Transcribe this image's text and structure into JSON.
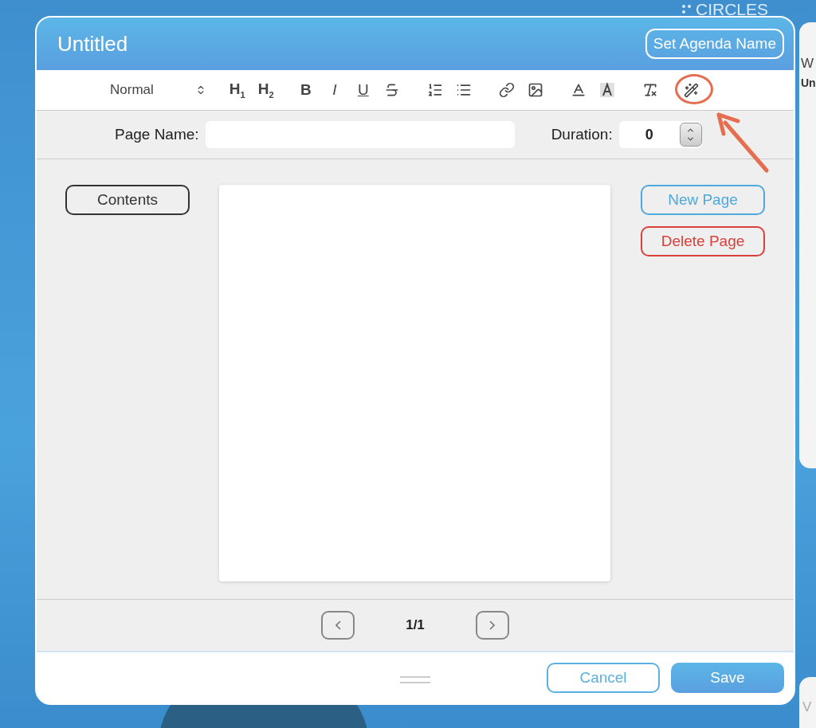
{
  "background": {
    "logo": "CIRCLES",
    "side_title": "W",
    "side_subtitle": "Un",
    "side_footer": "V"
  },
  "dialog": {
    "title": "Untitled",
    "set_name_button": "Set Agenda Name",
    "toolbar": {
      "format_select": "Normal",
      "tools": [
        {
          "kind": "heading",
          "label": "H$_{1}$",
          "highlighted": false
        },
        {
          "kind": "heading",
          "label": "H$_{2}$",
          "highlighted": false
        },
        {
          "kind": "bold",
          "label": "B",
          "highlighted": false
        },
        {
          "kind": "italic",
          "label": "I",
          "highlighted": false
        },
        {
          "kind": "underline",
          "label": "U",
          "highlighted": false
        },
        {
          "kind": "strike",
          "highlighted": false
        },
        {
          "kind": "ordered-list",
          "highlighted": false
        },
        {
          "kind": "bullet-list",
          "highlighted": false
        },
        {
          "kind": "link",
          "highlighted": false
        },
        {
          "kind": "image",
          "highlighted": false
        },
        {
          "kind": "text-color",
          "highlighted": false
        },
        {
          "kind": "background-color",
          "highlighted": false
        },
        {
          "kind": "clear-format",
          "highlighted": false
        },
        {
          "kind": "magic",
          "highlighted": true
        }
      ]
    },
    "page_name": {
      "label": "Page Name:"
    },
    "duration": {
      "label": "Duration:",
      "value": "0"
    },
    "contents_button": "Contents",
    "new_page_button": "New Page",
    "delete_page_button": "Delete Page",
    "pager": {
      "text": "1/1"
    },
    "cancel_button": "Cancel",
    "save_button": "Save"
  }
}
